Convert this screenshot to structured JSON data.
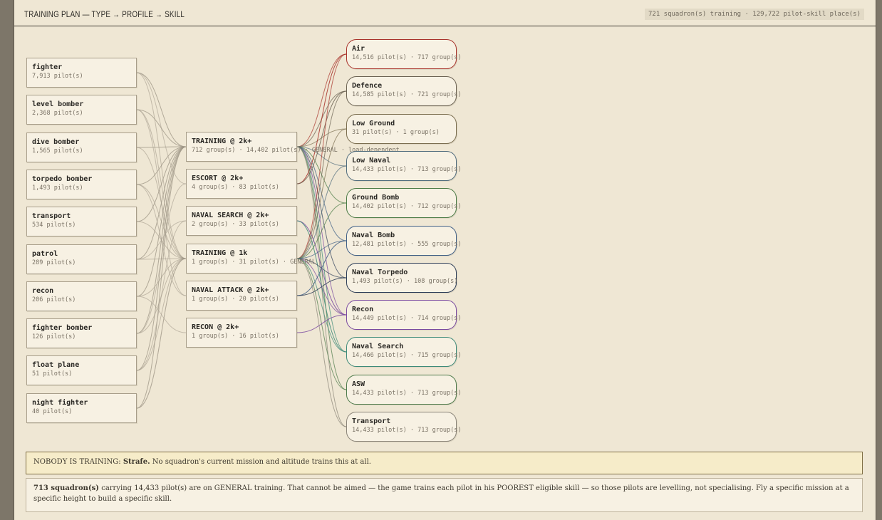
{
  "header": {
    "title": "TRAINING PLAN — TYPE → PROFILE → SKILL",
    "summary": "721 squadron(s) training · 129,722 pilot-skill place(s)"
  },
  "types": [
    {
      "name": "fighter",
      "sub": "7,913 pilot(s)"
    },
    {
      "name": "level bomber",
      "sub": "2,368 pilot(s)"
    },
    {
      "name": "dive bomber",
      "sub": "1,565 pilot(s)"
    },
    {
      "name": "torpedo bomber",
      "sub": "1,493 pilot(s)"
    },
    {
      "name": "transport",
      "sub": "534 pilot(s)"
    },
    {
      "name": "patrol",
      "sub": "289 pilot(s)"
    },
    {
      "name": "recon",
      "sub": "206 pilot(s)"
    },
    {
      "name": "fighter bomber",
      "sub": "126 pilot(s)"
    },
    {
      "name": "float plane",
      "sub": "51 pilot(s)"
    },
    {
      "name": "night fighter",
      "sub": "40 pilot(s)"
    }
  ],
  "profiles": [
    {
      "name": "TRAINING @ 2k+",
      "sub": "712 group(s) · 14,402 pilot(s) · GENERAL · load-dependent"
    },
    {
      "name": "ESCORT @ 2k+",
      "sub": "4 group(s) · 83 pilot(s)"
    },
    {
      "name": "NAVAL SEARCH @ 2k+",
      "sub": "2 group(s) · 33 pilot(s)"
    },
    {
      "name": "TRAINING @ 1k",
      "sub": "1 group(s) · 31 pilot(s) · GENERAL"
    },
    {
      "name": "NAVAL ATTACK @ 2k+",
      "sub": "1 group(s) · 20 pilot(s)"
    },
    {
      "name": "RECON @ 2k+",
      "sub": "1 group(s) · 16 pilot(s)"
    }
  ],
  "skills": [
    {
      "name": "Air",
      "sub": "14,516 pilot(s) · 717 group(s)",
      "color": "#a8322a"
    },
    {
      "name": "Defence",
      "sub": "14,585 pilot(s) · 721 group(s)",
      "color": "#6b6252"
    },
    {
      "name": "Low Ground",
      "sub": "31 pilot(s) · 1 group(s)",
      "color": "#7a6d4e"
    },
    {
      "name": "Low Naval",
      "sub": "14,433 pilot(s) · 713 group(s)",
      "color": "#4f6b7c"
    },
    {
      "name": "Ground Bomb",
      "sub": "14,402 pilot(s) · 712 group(s)",
      "color": "#4a7a44"
    },
    {
      "name": "Naval Bomb",
      "sub": "12,481 pilot(s) · 555 group(s)",
      "color": "#3f5f86"
    },
    {
      "name": "Naval Torpedo",
      "sub": "1,493 pilot(s) · 108 group(s)",
      "color": "#2e3e58"
    },
    {
      "name": "Recon",
      "sub": "14,449 pilot(s) · 714 group(s)",
      "color": "#7a4aa0"
    },
    {
      "name": "Naval Search",
      "sub": "14,466 pilot(s) · 715 group(s)",
      "color": "#3d8a78"
    },
    {
      "name": "ASW",
      "sub": "14,433 pilot(s) · 713 group(s)",
      "color": "#4d7a4a"
    },
    {
      "name": "Transport",
      "sub": "14,433 pilot(s) · 713 group(s)",
      "color": "#8a8478"
    }
  ],
  "alert": {
    "lead": "NOBODY IS TRAINING:",
    "skill": "Strafe.",
    "text": "No squadron's current mission and altitude trains this at all."
  },
  "note": {
    "lead": "713 squadron(s)",
    "text": "carrying 14,433 pilot(s) are on GENERAL training. That cannot be aimed — the game trains each pilot in his POOREST eligible skill — so those pilots are levelling, not specialising. Fly a specific mission at a specific height to build a specific skill."
  },
  "colors": {
    "panel": "#efe7d4",
    "card": "#f7f1e3",
    "alert_bg": "#f6ecc9",
    "frame": "#7d7669"
  }
}
